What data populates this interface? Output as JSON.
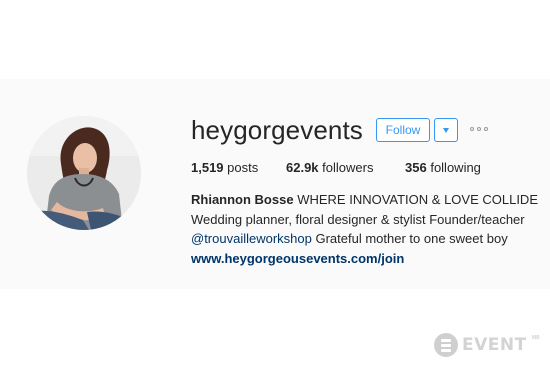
{
  "profile": {
    "username": "heygorgevents",
    "follow_label": "Follow",
    "dropdown_icon": "caret-down-icon",
    "more_icon": "more-options-icon",
    "avatar_icon": "profile-photo"
  },
  "stats": {
    "posts_count": "1,519",
    "posts_label": "posts",
    "followers_count": "62.9k",
    "followers_label": "followers",
    "following_count": "356",
    "following_label": "following"
  },
  "bio": {
    "name": "Rhiannon Bosse",
    "tagline": "WHERE INNOVATION & LOVE COLLIDE",
    "line2": "Wedding planner, floral designer & stylist Founder/teacher",
    "mention": "@trouvailleworkshop",
    "line3_rest": "Grateful mother to one sweet boy",
    "link": "www.heygorgeousevents.com/join"
  },
  "watermark": {
    "text": "EVENT",
    "superscript": "MB"
  },
  "colors": {
    "accent": "#3897f0",
    "text": "#262626",
    "link": "#003569",
    "band": "#fafafa",
    "watermark": "#d3d3d3"
  }
}
